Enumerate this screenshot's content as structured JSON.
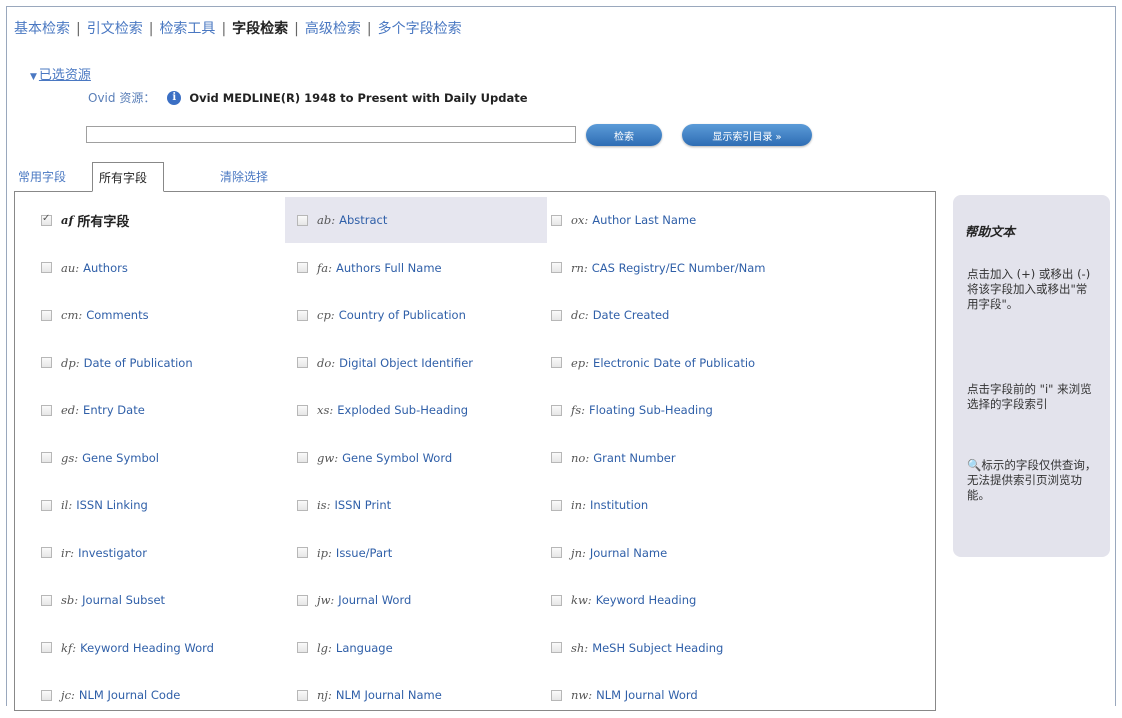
{
  "nav": {
    "items": [
      "基本检索",
      "引文检索",
      "检索工具",
      "字段检索",
      "高级检索",
      "多个字段检索"
    ],
    "active_index": 3
  },
  "resources": {
    "toggle_label": "已选资源",
    "source_label": "Ovid 资源：",
    "source_name": "Ovid MEDLINE(R) 1948 to Present with Daily Update"
  },
  "search": {
    "value": "",
    "search_button": "检索",
    "index_button": "显示索引目录 »"
  },
  "tabs": {
    "common": "常用字段",
    "all": "所有字段",
    "clear": "清除选择"
  },
  "fields": [
    {
      "code": "af",
      "name": "所有字段",
      "checked": true,
      "bold": true
    },
    {
      "code": "ab:",
      "name": "Abstract",
      "checked": false,
      "highlight": true
    },
    {
      "code": "ox:",
      "name": "Author Last Name",
      "checked": false
    },
    {
      "code": "au:",
      "name": "Authors",
      "checked": false
    },
    {
      "code": "fa:",
      "name": "Authors Full Name",
      "checked": false
    },
    {
      "code": "rn:",
      "name": "CAS Registry/EC Number/Nam",
      "checked": false
    },
    {
      "code": "cm:",
      "name": "Comments",
      "checked": false
    },
    {
      "code": "cp:",
      "name": "Country of Publication",
      "checked": false
    },
    {
      "code": "dc:",
      "name": "Date Created",
      "checked": false
    },
    {
      "code": "dp:",
      "name": "Date of Publication",
      "checked": false
    },
    {
      "code": "do:",
      "name": "Digital Object Identifier",
      "checked": false
    },
    {
      "code": "ep:",
      "name": "Electronic Date of Publicatio",
      "checked": false
    },
    {
      "code": "ed:",
      "name": "Entry Date",
      "checked": false
    },
    {
      "code": "xs:",
      "name": "Exploded Sub-Heading",
      "checked": false
    },
    {
      "code": "fs:",
      "name": "Floating Sub-Heading",
      "checked": false
    },
    {
      "code": "gs:",
      "name": "Gene Symbol",
      "checked": false
    },
    {
      "code": "gw:",
      "name": "Gene Symbol Word",
      "checked": false
    },
    {
      "code": "no:",
      "name": "Grant Number",
      "checked": false
    },
    {
      "code": "il:",
      "name": "ISSN Linking",
      "checked": false
    },
    {
      "code": "is:",
      "name": "ISSN Print",
      "checked": false
    },
    {
      "code": "in:",
      "name": "Institution",
      "checked": false
    },
    {
      "code": "ir:",
      "name": "Investigator",
      "checked": false
    },
    {
      "code": "ip:",
      "name": "Issue/Part",
      "checked": false
    },
    {
      "code": "jn:",
      "name": "Journal Name",
      "checked": false
    },
    {
      "code": "sb:",
      "name": "Journal Subset",
      "checked": false
    },
    {
      "code": "jw:",
      "name": "Journal Word",
      "checked": false
    },
    {
      "code": "kw:",
      "name": "Keyword Heading",
      "checked": false
    },
    {
      "code": "kf:",
      "name": "Keyword Heading Word",
      "checked": false
    },
    {
      "code": "lg:",
      "name": "Language",
      "checked": false
    },
    {
      "code": "sh:",
      "name": "MeSH Subject Heading",
      "checked": false
    },
    {
      "code": "jc:",
      "name": "NLM Journal Code",
      "checked": false
    },
    {
      "code": "nj:",
      "name": "NLM Journal Name",
      "checked": false
    },
    {
      "code": "nw:",
      "name": "NLM Journal Word",
      "checked": false
    }
  ],
  "help": {
    "title": "帮助文本",
    "p1": "点击加入 (+) 或移出 (-) 将该字段加入或移出\"常用字段\"。",
    "p2": "点击字段前的 \"i\" 来浏览选择的字段索引",
    "p3": "标示的字段仅供查询，无法提供索引页浏览功能。",
    "icon": "magnifier-icon",
    "icon_color": "#dd3333"
  },
  "colors": {
    "link": "#4a78c2",
    "button": "#2e6db4",
    "help_bg": "#e3e3ec"
  }
}
